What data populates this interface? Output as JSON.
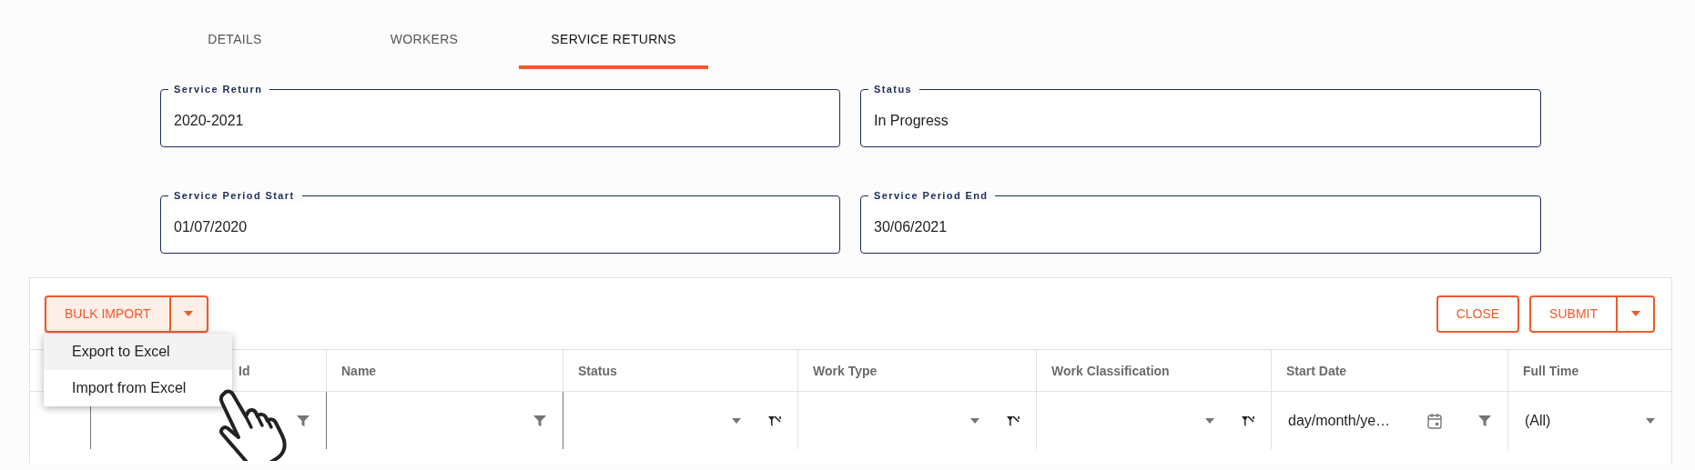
{
  "tabs": [
    {
      "label": "DETAILS",
      "selected": false
    },
    {
      "label": "WORKERS",
      "selected": false
    },
    {
      "label": "SERVICE RETURNS",
      "selected": true
    }
  ],
  "fields": [
    {
      "label": "Service Return",
      "value": "2020-2021"
    },
    {
      "label": "Status",
      "value": "In Progress"
    },
    {
      "label": "Service Period Start",
      "value": "01/07/2020"
    },
    {
      "label": "Service Period End",
      "value": "30/06/2021"
    }
  ],
  "toolbar": {
    "bulk_import": "BULK IMPORT",
    "close": "CLOSE",
    "submit": "SUBMIT"
  },
  "menu": [
    {
      "label": "Export to Excel",
      "selected": true
    },
    {
      "label": "Import from Excel",
      "selected": false
    }
  ],
  "columns": [
    {
      "header": "Id",
      "kind": "text"
    },
    {
      "header": "Name",
      "kind": "text"
    },
    {
      "header": "Status",
      "kind": "select"
    },
    {
      "header": "Work Type",
      "kind": "select"
    },
    {
      "header": "Work Classification",
      "kind": "select"
    },
    {
      "header": "Start Date",
      "kind": "date",
      "placeholder": "day/month/ye…"
    },
    {
      "header": "Full Time",
      "kind": "dropdown",
      "value": "(All)"
    }
  ]
}
